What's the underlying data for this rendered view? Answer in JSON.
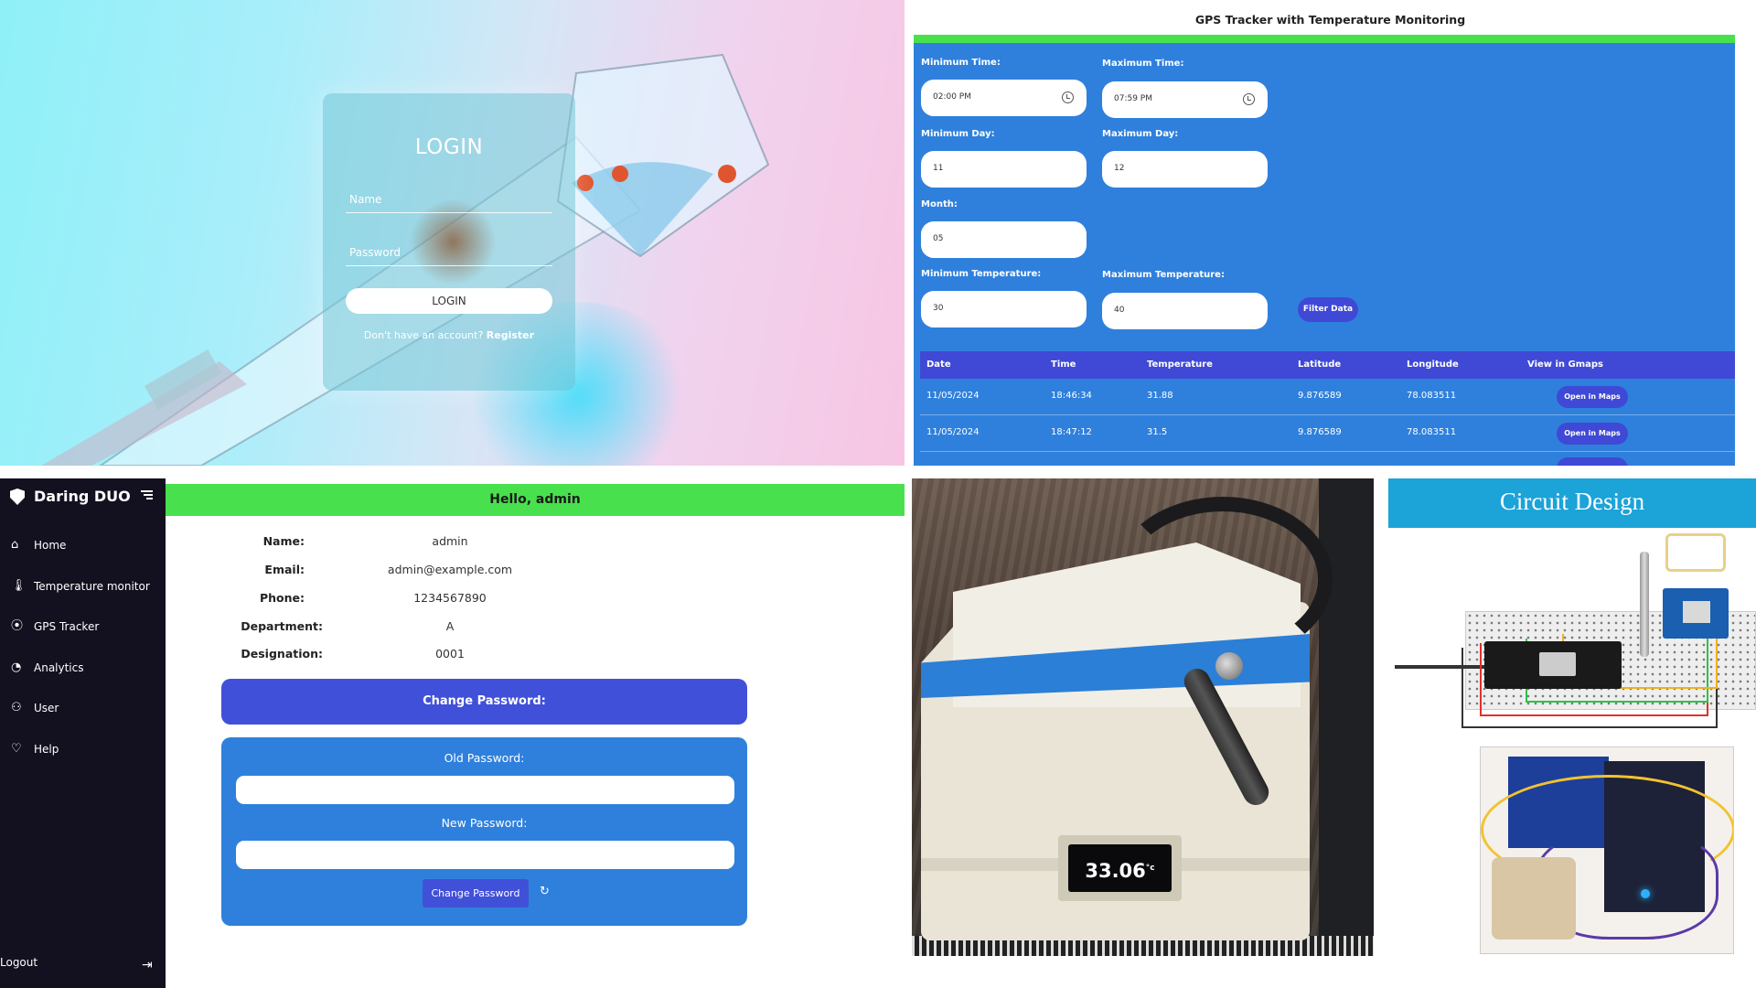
{
  "login": {
    "title": "LOGIN",
    "name_placeholder": "Name",
    "password_placeholder": "Password",
    "button_label": "LOGIN",
    "register_prompt": "Don't have an account?",
    "register_link": "Register"
  },
  "gps": {
    "title": "GPS Tracker with Temperature Monitoring",
    "labels": {
      "min_time": "Minimum Time:",
      "max_time": "Maximum Time:",
      "min_day": "Minimum Day:",
      "max_day": "Maximum Day:",
      "month": "Month:",
      "min_temp": "Minimum Temperature:",
      "max_temp": "Maximum Temperature:"
    },
    "values": {
      "min_time": "02:00 PM",
      "max_time": "07:59 PM",
      "min_day": "11",
      "max_day": "12",
      "month": "05",
      "min_temp": "30",
      "max_temp": "40"
    },
    "filter_button": "Filter Data",
    "columns": [
      "Date",
      "Time",
      "Temperature",
      "Latitude",
      "Longitude",
      "View in Gmaps"
    ],
    "rows": [
      {
        "date": "11/05/2024",
        "time": "18:46:34",
        "temperature": "31.88",
        "latitude": "9.876589",
        "longitude": "78.083511",
        "action": "Open in Maps"
      },
      {
        "date": "11/05/2024",
        "time": "18:47:12",
        "temperature": "31.5",
        "latitude": "9.876589",
        "longitude": "78.083511",
        "action": "Open in Maps"
      }
    ]
  },
  "dashboard": {
    "brand": "Daring DUO",
    "nav": [
      {
        "label": "Home",
        "icon": "home-icon"
      },
      {
        "label": "Temperature monitor",
        "icon": "thermometer-icon"
      },
      {
        "label": "GPS Tracker",
        "icon": "location-pin-icon"
      },
      {
        "label": "Analytics",
        "icon": "pie-chart-icon"
      },
      {
        "label": "User",
        "icon": "user-icon"
      },
      {
        "label": "Help",
        "icon": "heart-icon"
      }
    ],
    "logout": "Logout",
    "greeting": "Hello, admin",
    "profile": [
      {
        "key": "Name:",
        "value": "admin"
      },
      {
        "key": "Email:",
        "value": "admin@example.com"
      },
      {
        "key": "Phone:",
        "value": "1234567890"
      },
      {
        "key": "Department:",
        "value": "A"
      },
      {
        "key": "Designation:",
        "value": "0001"
      }
    ],
    "change_password_header": "Change Password:",
    "old_password_label": "Old Password:",
    "new_password_label": "New Password:",
    "change_password_button": "Change Password"
  },
  "device": {
    "display_reading": "33.06",
    "display_unit": "°c"
  },
  "circuit": {
    "title": "Circuit Design"
  },
  "colors": {
    "accent_green": "#49e04e",
    "panel_blue": "#2f80dc",
    "button_indigo": "#3f49d6",
    "sidebar_dark": "#13111f"
  }
}
